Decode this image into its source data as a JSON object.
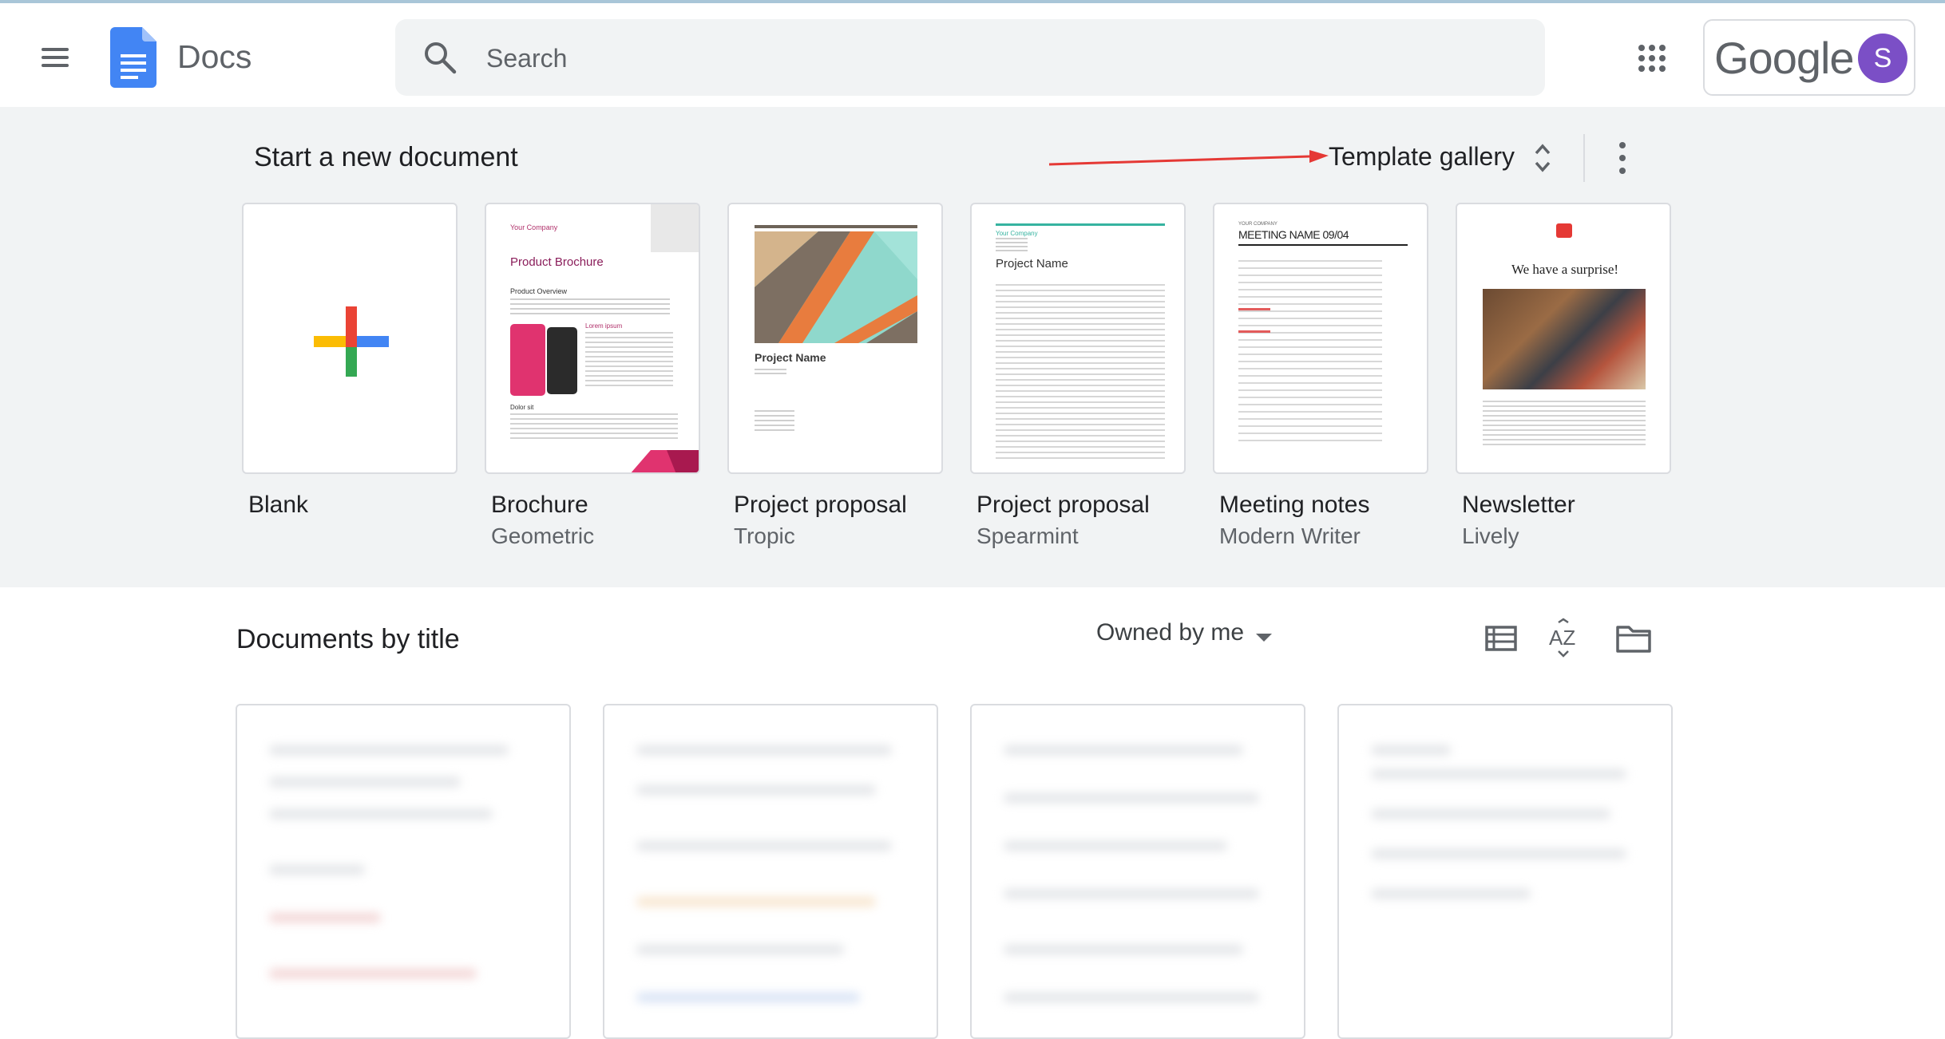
{
  "header": {
    "app_name": "Docs",
    "search_placeholder": "Search",
    "brand": "Google",
    "avatar_initial": "S"
  },
  "templates": {
    "section_title": "Start a new document",
    "gallery_label": "Template gallery",
    "items": [
      {
        "name": "Blank",
        "sub": ""
      },
      {
        "name": "Brochure",
        "sub": "Geometric"
      },
      {
        "name": "Project proposal",
        "sub": "Tropic"
      },
      {
        "name": "Project proposal",
        "sub": "Spearmint"
      },
      {
        "name": "Meeting notes",
        "sub": "Modern Writer"
      },
      {
        "name": "Newsletter",
        "sub": "Lively"
      }
    ],
    "thumb_text": {
      "brochure_company": "Your Company",
      "brochure_title": "Product Brochure",
      "brochure_overview": "Product Overview",
      "brochure_lorem": "Lorem ipsum",
      "brochure_dolor": "Dolor sit",
      "tropic_title": "Project Name",
      "spearmint_company": "Your Company",
      "spearmint_title": "Project Name",
      "meeting_company": "YOUR COMPANY",
      "meeting_title": "MEETING NAME 09/04",
      "newsletter_title": "We have a surprise!"
    }
  },
  "documents": {
    "section_title": "Documents by title",
    "owner_filter": "Owned by me"
  },
  "colors": {
    "accent_blue": "#4285f4",
    "avatar": "#7b4fc6",
    "annotation_arrow": "#e53935",
    "band_bg": "#f1f3f4"
  },
  "icons": [
    "menu-icon",
    "docs-logo-icon",
    "search-icon",
    "apps-grid-icon",
    "sort-chevrons-icon",
    "more-vert-icon",
    "list-view-icon",
    "sort-az-icon",
    "folder-icon"
  ]
}
